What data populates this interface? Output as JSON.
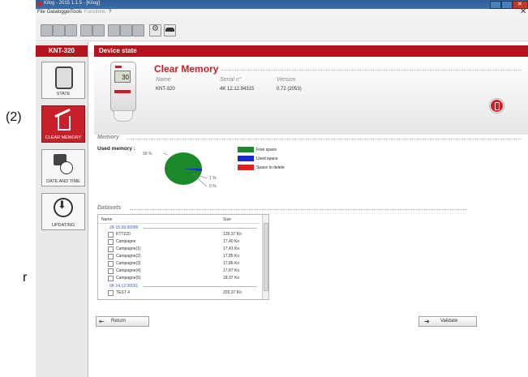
{
  "window": {
    "title": "Kilog - 2015 1.1.5 - [Kilog]"
  },
  "menu": [
    "File",
    "Datalogger",
    "Tools",
    "Functions",
    "?"
  ],
  "annotations": {
    "marker": "(2)",
    "letter": "r"
  },
  "sidebar": {
    "header": "KNT-320",
    "items": [
      {
        "label": "STATE",
        "icon": "device-icon",
        "active": false
      },
      {
        "label": "CLEAR MEMORY",
        "icon": "trash-icon",
        "active": true
      },
      {
        "label": "DATE AND TIME",
        "icon": "calendar-clock-icon",
        "active": false
      },
      {
        "label": "UPDATING",
        "icon": "download-icon",
        "active": false
      }
    ]
  },
  "main": {
    "header": "Device state",
    "device": {
      "title": "Clear Memory",
      "name_label": "Name",
      "serial_label": "Serial n°",
      "version_label": "Version",
      "name": "KNT-320",
      "serial": "4K 12.12.94315",
      "version": "0.72 (2053)",
      "lcd": "30"
    },
    "memory": {
      "section_title": "Memory",
      "used_label": "Used memory :",
      "pct_free": "99 %",
      "pct_used": "1 %",
      "pct_delete": "0 %",
      "legend": [
        {
          "label": "Free space",
          "color": "#1a8a2a"
        },
        {
          "label": "Used space",
          "color": "#1a2acc"
        },
        {
          "label": "Space to delete",
          "color": "#e02020"
        }
      ]
    },
    "datasets": {
      "section_title": "Datasets",
      "col_name": "Name",
      "col_size": "Size",
      "groups": [
        {
          "header": "2K 15.09.99999",
          "rows": [
            {
              "name": "KTT220",
              "size": "139,37 Ko"
            },
            {
              "name": "Campagne",
              "size": "17,40 Ko"
            },
            {
              "name": "Campagne(1)",
              "size": "17,41 Ko"
            },
            {
              "name": "Campagne(2)",
              "size": "17,85 Ko"
            },
            {
              "name": "Campagne(3)",
              "size": "17,86 Ko"
            },
            {
              "name": "Campagne(4)",
              "size": "17,87 Ko"
            },
            {
              "name": "Campagne(5)",
              "size": "18,37 Ko"
            }
          ]
        },
        {
          "header": "0K 14.12.00031",
          "rows": [
            {
              "name": "TEST 4",
              "size": "203,37 Ko"
            }
          ]
        }
      ]
    },
    "buttons": {
      "return": "Return",
      "validate": "Validate"
    }
  }
}
